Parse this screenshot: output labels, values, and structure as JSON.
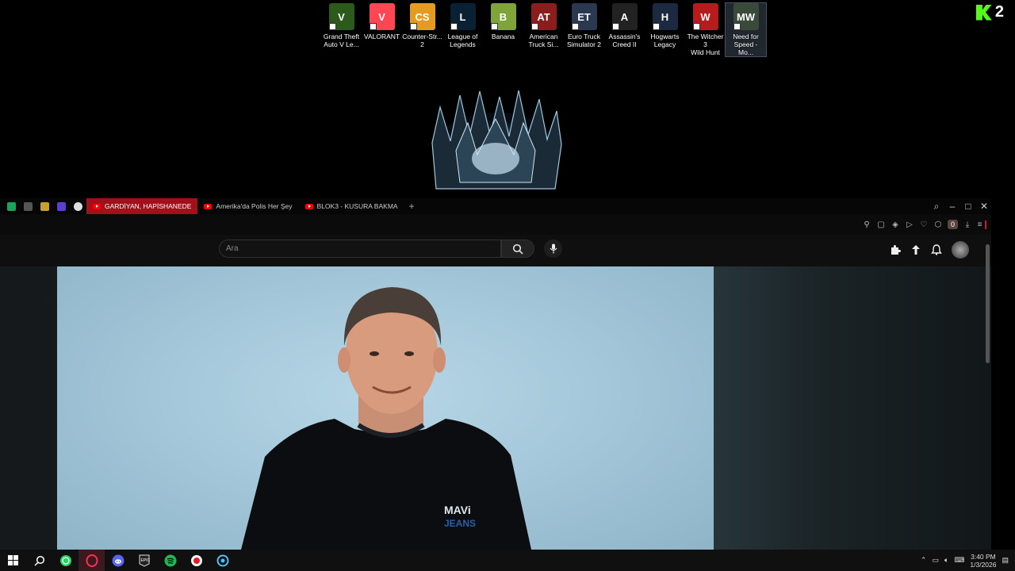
{
  "desktop": {
    "icons": [
      {
        "label": "Grand Theft\nAuto V Le...",
        "icon": "gta-v-icon",
        "mark": "V",
        "color": "#2b5a1a"
      },
      {
        "label": "VALORANT",
        "icon": "valorant-icon",
        "mark": "V",
        "color": "#ff4655"
      },
      {
        "label": "Counter-Str...\n2",
        "icon": "counter-strike-icon",
        "mark": "CS",
        "color": "#e49b20"
      },
      {
        "label": "League of\nLegends",
        "icon": "league-of-legends-icon",
        "mark": "L",
        "color": "#0a2033"
      },
      {
        "label": "Banana",
        "icon": "banana-icon",
        "mark": "B",
        "color": "#7fa53a"
      },
      {
        "label": "American\nTruck Si...",
        "icon": "american-truck-icon",
        "mark": "AT",
        "color": "#8a1d1d"
      },
      {
        "label": "Euro Truck\nSimulator 2",
        "icon": "euro-truck-icon",
        "mark": "ET",
        "color": "#2a3850"
      },
      {
        "label": "Assassin's\nCreed II",
        "icon": "assassins-creed-icon",
        "mark": "A",
        "color": "#222"
      },
      {
        "label": "Hogwarts\nLegacy",
        "icon": "hogwarts-legacy-icon",
        "mark": "H",
        "color": "#1b2a40"
      },
      {
        "label": "The Witcher 3\nWild Hunt",
        "icon": "witcher-icon",
        "mark": "W",
        "color": "#b71c1c"
      },
      {
        "label": "Need for\nSpeed - Mo...",
        "icon": "need-for-speed-icon",
        "mark": "MW",
        "color": "#3a4a3a"
      }
    ],
    "brand_number": "2"
  },
  "browser": {
    "tabs": [
      {
        "title": "GARDİYAN, HAPİSHANEDE"
      },
      {
        "title": "Amerika'da Polis Her Şey"
      },
      {
        "title": "BLOK3 - KUSURA BAKMA"
      }
    ],
    "new_tab": "+",
    "toolbar_badge": "0",
    "search": {
      "placeholder": "Ara"
    }
  },
  "taskbar": {
    "time": "3:40 PM",
    "date": "1/3/2026"
  },
  "colors": {
    "accent_red": "#d0182f",
    "kick_green": "#53fc18",
    "youtube_red": "#ff0000"
  }
}
